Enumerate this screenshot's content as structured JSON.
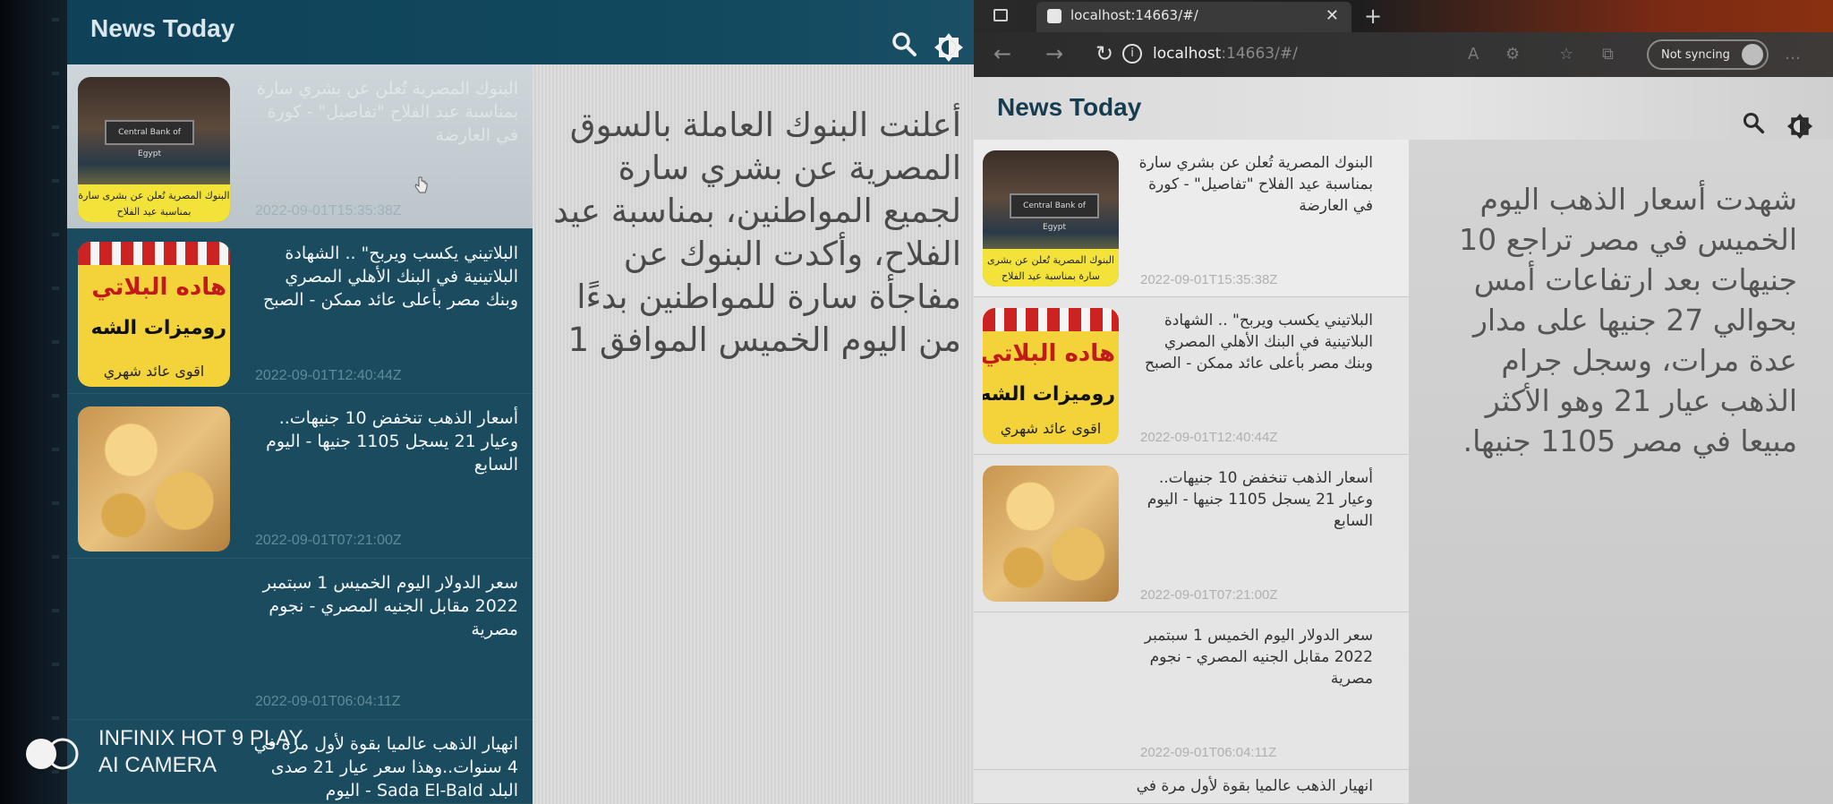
{
  "left_app": {
    "title": "News Today",
    "articles": [
      {
        "headline": "البنوك المصرية تُعلن عن بشري سارة بمناسبة عيد الفلاح \"تفاصيل\" - كورة في العارضة",
        "date": "2022-09-01T15:35:38Z",
        "thumb_banner": "البنوك المصرية تُعلن عن بشرى سارة بمناسبة عيد الفلاح",
        "thumb_sign": "Central Bank of Egypt"
      },
      {
        "headline": "البلاتيني يكسب ويربح\" .. الشهادة البلاتينية في البنك الأهلي المصري وبنك مصر بأعلى عائد ممكن - الصبح",
        "date": "2022-09-01T12:40:44Z",
        "thumb_l1": "هاده البلاتي",
        "thumb_l2": "روميزات الشه",
        "thumb_l3": "اقوى عائد شهري"
      },
      {
        "headline": "أسعار الذهب تنخفض 10 جنيهات.. وعيار 21 يسجل 1105 جنيها - اليوم السابع",
        "date": "2022-09-01T07:21:00Z"
      },
      {
        "headline": "سعر الدولار اليوم الخميس 1 سبتمبر 2022 مقابل الجنيه المصري - نجوم مصرية",
        "date": "2022-09-01T06:04:11Z"
      },
      {
        "headline": "انهيار الذهب عالميا بقوة لأول مرة في 4 سنوات..وهذا سعر عيار 21 صدى البلد Sada El-Bald - اليوم",
        "date": ""
      }
    ],
    "detail_text": "أعلنت البنوك العاملة بالسوق المصرية عن بشري سارة لجميع المواطنين، بمناسبة عيد الفلاح، وأكدت البنوك عن مفاجأة سارة للمواطنين بدءًا من اليوم الخميس الموافق 1"
  },
  "browser": {
    "tab_title": "localhost:14663/#/",
    "url_host": "localhost",
    "url_rest": ":14663/#/",
    "sync_label": "Not syncing",
    "app_title": "News Today",
    "articles": [
      {
        "headline": "البنوك المصرية تُعلن عن بشري سارة بمناسبة عيد الفلاح \"تفاصيل\" - كورة في العارضة",
        "date": "2022-09-01T15:35:38Z",
        "thumb_banner": "البنوك المصرية تُعلن عن بشرى سارة بمناسبة عيد الفلاح",
        "thumb_sign": "Central Bank of Egypt"
      },
      {
        "headline": "البلاتيني يكسب ويربح\" .. الشهادة البلاتينية في البنك الأهلي المصري وبنك مصر بأعلى عائد ممكن - الصبح",
        "date": "2022-09-01T12:40:44Z",
        "thumb_l1": "هاده البلاتي",
        "thumb_l2": "روميزات الشه",
        "thumb_l3": "اقوى عائد شهري"
      },
      {
        "headline": "أسعار الذهب تنخفض 10 جنيهات.. وعيار 21 يسجل 1105 جنيها - اليوم السابع",
        "date": "2022-09-01T07:21:00Z"
      },
      {
        "headline": "سعر الدولار اليوم الخميس 1 سبتمبر 2022 مقابل الجنيه المصري - نجوم مصرية",
        "date": "2022-09-01T06:04:11Z"
      },
      {
        "headline": "انهيار الذهب عالميا بقوة لأول مرة في",
        "date": ""
      }
    ],
    "detail_text": "شهدت أسعار الذهب اليوم الخميس في مصر تراجع 10 جنيهات بعد ارتفاعات أمس بحوالي 27 جنيها على مدار عدة مرات، وسجل جرام الذهب عيار 21 وهو الأكثر مبيعا في مصر 1105 جنيها."
  },
  "watermark": {
    "line1": "INFINIX HOT 9 PLAY",
    "line2": "AI CAMERA"
  },
  "icons": {
    "search": "search-icon",
    "theme": "brightness-icon",
    "back": "arrow-left-icon",
    "forward": "arrow-right-icon",
    "reload": "reload-icon",
    "close": "close-icon",
    "new_tab": "plus-icon"
  },
  "colors": {
    "left_appbar": "#12495f",
    "left_list": "#1a4b5f",
    "right_appbar_title": "#163c50"
  }
}
